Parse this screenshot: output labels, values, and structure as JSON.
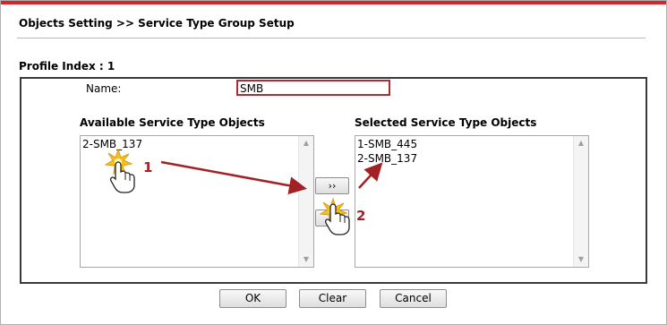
{
  "header": {
    "title": "Objects Setting >> Service Type Group Setup"
  },
  "profile": {
    "index_label": "Profile Index : 1"
  },
  "name_field": {
    "label": "Name:",
    "value": "SMB"
  },
  "available": {
    "heading": "Available Service Type Objects",
    "items": [
      "2-SMB_137"
    ]
  },
  "selected": {
    "heading": "Selected Service Type Objects",
    "items": [
      "1-SMB_445",
      "2-SMB_137"
    ]
  },
  "controls": {
    "move_right_label": "››",
    "move_left_label": ""
  },
  "annotations": {
    "step1": "1",
    "step2": "2"
  },
  "buttons": {
    "ok": "OK",
    "clear": "Clear",
    "cancel": "Cancel"
  },
  "colors": {
    "accent_red": "#d6252b",
    "annotation_red": "#a32024",
    "input_border": "#b12a2f"
  },
  "icons": [
    "hand-pointer-icon",
    "starburst-click-icon",
    "arrow-icon",
    "scroll-up-icon",
    "scroll-down-icon"
  ]
}
